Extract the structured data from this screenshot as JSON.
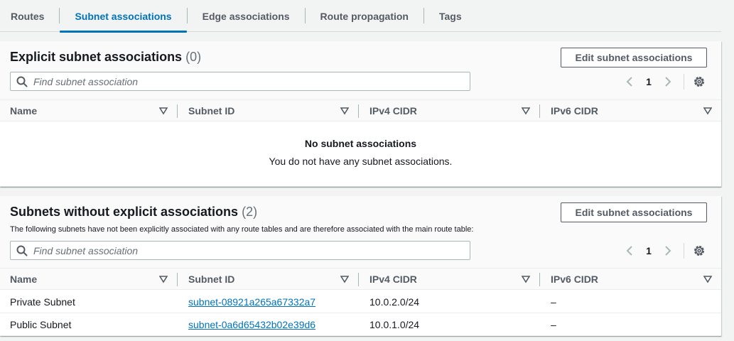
{
  "tabs": [
    {
      "label": "Routes"
    },
    {
      "label": "Subnet associations"
    },
    {
      "label": "Edge associations"
    },
    {
      "label": "Route propagation"
    },
    {
      "label": "Tags"
    }
  ],
  "explicit": {
    "title": "Explicit subnet associations",
    "count": "(0)",
    "edit_label": "Edit subnet associations",
    "search_placeholder": "Find subnet association",
    "page": "1",
    "columns": [
      "Name",
      "Subnet ID",
      "IPv4 CIDR",
      "IPv6 CIDR"
    ],
    "empty_title": "No subnet associations",
    "empty_message": "You do not have any subnet associations."
  },
  "implicit": {
    "title": "Subnets without explicit associations",
    "count": "(2)",
    "description": "The following subnets have not been explicitly associated with any route tables and are therefore associated with the main route table:",
    "edit_label": "Edit subnet associations",
    "search_placeholder": "Find subnet association",
    "page": "1",
    "columns": [
      "Name",
      "Subnet ID",
      "IPv4 CIDR",
      "IPv6 CIDR"
    ],
    "rows": [
      {
        "name": "Private Subnet",
        "subnet_id": "subnet-08921a265a67332a7",
        "ipv4": "10.0.2.0/24",
        "ipv6": "–"
      },
      {
        "name": "Public Subnet",
        "subnet_id": "subnet-0a6d65432b02e39d6",
        "ipv4": "10.0.1.0/24",
        "ipv6": "–"
      }
    ]
  },
  "icons": {
    "search": "search-icon",
    "prev": "chevron-left-icon",
    "next": "chevron-right-icon",
    "settings": "gear-icon",
    "sort": "caret-down-icon"
  },
  "colors": {
    "accent": "#0073bb",
    "background": "#f2f3f3",
    "panel_header": "#fafafa",
    "text": "#16191f",
    "muted": "#545b64"
  }
}
